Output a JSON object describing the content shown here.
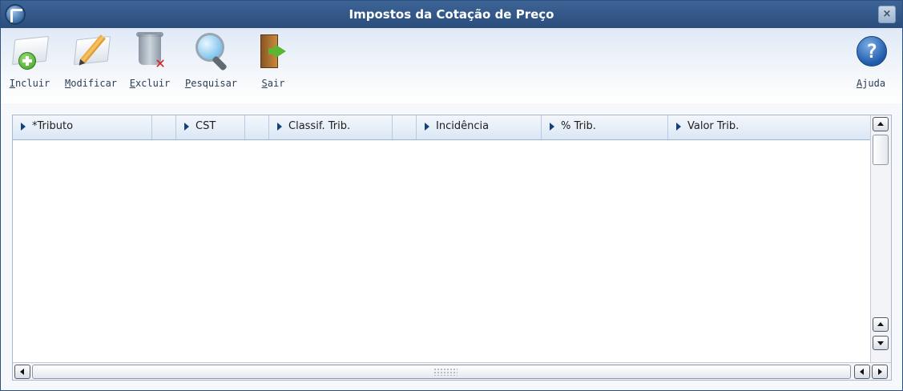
{
  "window": {
    "title": "Impostos da Cotação de Preço",
    "close_label": "×"
  },
  "toolbar": {
    "buttons": [
      {
        "label": "Incluir",
        "icon": "add-document-icon"
      },
      {
        "label": "Modificar",
        "icon": "edit-pencil-icon"
      },
      {
        "label": "Excluir",
        "icon": "trash-delete-icon"
      },
      {
        "label": "Pesquisar",
        "icon": "magnifier-search-icon"
      },
      {
        "label": "Sair",
        "icon": "exit-door-icon"
      }
    ],
    "help": {
      "label": "Ajuda",
      "icon": "help-icon",
      "glyph": "?"
    }
  },
  "grid": {
    "columns": [
      "*Tributo",
      "",
      "CST",
      "",
      "Classif. Trib.",
      "",
      "Incidência",
      "% Trib.",
      "Valor Trib."
    ],
    "rows": []
  },
  "colors": {
    "titlebar": "#2f5685",
    "header_bg": "#dbe7f5",
    "sort_arrow": "#17407a"
  }
}
